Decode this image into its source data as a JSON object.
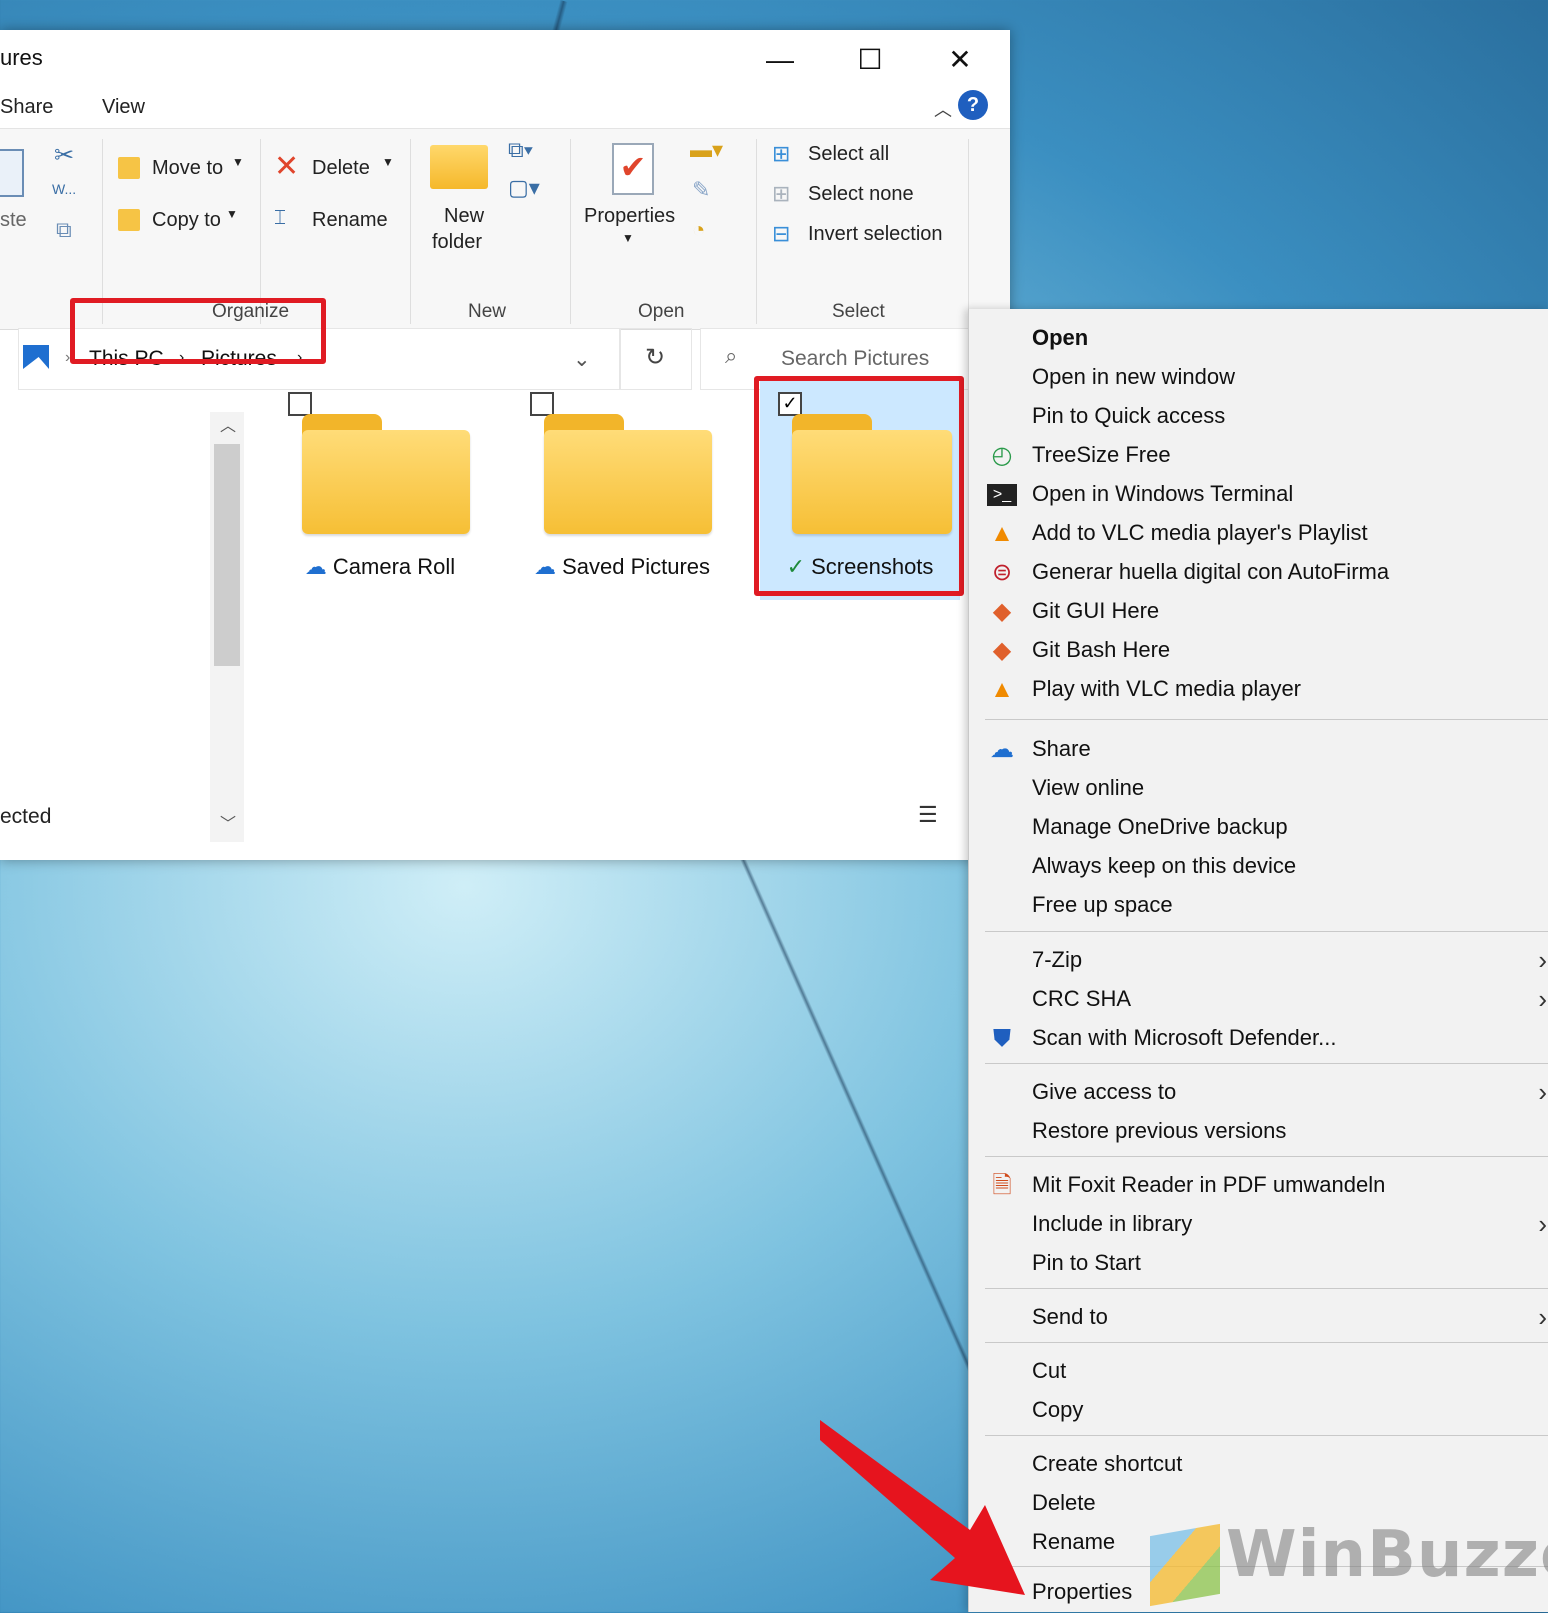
{
  "window": {
    "title": "ures",
    "tabs": [
      "Share",
      "View"
    ],
    "controls": {
      "minimize": "—",
      "maximize": "☐",
      "close": "✕"
    },
    "help": "?"
  },
  "ribbon": {
    "clipboard_paste": "ste",
    "move_to": "Move to",
    "copy_to": "Copy to",
    "delete": "Delete",
    "rename": "Rename",
    "new_folder_line1": "New",
    "new_folder_line2": "folder",
    "properties": "Properties",
    "select_all": "Select all",
    "select_none": "Select none",
    "invert_selection": "Invert selection",
    "groups": {
      "organize": "Organize",
      "new": "New",
      "open": "Open",
      "select": "Select"
    }
  },
  "address": {
    "crumbs": [
      "This PC",
      "Pictures"
    ],
    "search_placeholder": "Search Pictures"
  },
  "folders": [
    {
      "name": "Camera Roll",
      "status_icon": "cloud-icon",
      "checked": false
    },
    {
      "name": "Saved Pictures",
      "status_icon": "cloud-icon",
      "checked": false
    },
    {
      "name": "Screenshots",
      "status_icon": "synced-check-icon",
      "checked": true
    }
  ],
  "status_bar": {
    "text": "ected"
  },
  "context_menu": {
    "items": [
      {
        "label": "Open",
        "bold": true
      },
      {
        "label": "Open in new window"
      },
      {
        "label": "Pin to Quick access"
      },
      {
        "label": "TreeSize Free",
        "icon": "treesize-icon"
      },
      {
        "label": "Open in Windows Terminal",
        "icon": "terminal-icon"
      },
      {
        "label": "Add to VLC media player's Playlist",
        "icon": "vlc-icon"
      },
      {
        "label": "Generar huella digital con AutoFirma",
        "icon": "autofirma-icon"
      },
      {
        "label": "Git GUI Here",
        "icon": "git-icon"
      },
      {
        "label": "Git Bash Here",
        "icon": "git-icon"
      },
      {
        "label": "Play with VLC media player",
        "icon": "vlc-icon"
      },
      {
        "label": "Share",
        "icon": "onedrive-icon"
      },
      {
        "label": "View online"
      },
      {
        "label": "Manage OneDrive backup"
      },
      {
        "label": "Always keep on this device"
      },
      {
        "label": "Free up space"
      },
      {
        "label": "7-Zip",
        "submenu": true
      },
      {
        "label": "CRC SHA",
        "submenu": true
      },
      {
        "label": "Scan with Microsoft Defender...",
        "icon": "defender-icon"
      },
      {
        "label": "Give access to",
        "submenu": true
      },
      {
        "label": "Restore previous versions"
      },
      {
        "label": "Mit Foxit Reader in PDF umwandeln",
        "icon": "foxit-icon"
      },
      {
        "label": "Include in library",
        "submenu": true
      },
      {
        "label": "Pin to Start"
      },
      {
        "label": "Send to",
        "submenu": true
      },
      {
        "label": "Cut"
      },
      {
        "label": "Copy"
      },
      {
        "label": "Create shortcut"
      },
      {
        "label": "Delete"
      },
      {
        "label": "Rename"
      },
      {
        "label": "Properties"
      }
    ]
  },
  "watermark": "WinBuzze",
  "colors": {
    "highlight_red": "#e01b23",
    "selection_blue": "#cce8ff",
    "folder_yellow": "#f6bf35"
  }
}
